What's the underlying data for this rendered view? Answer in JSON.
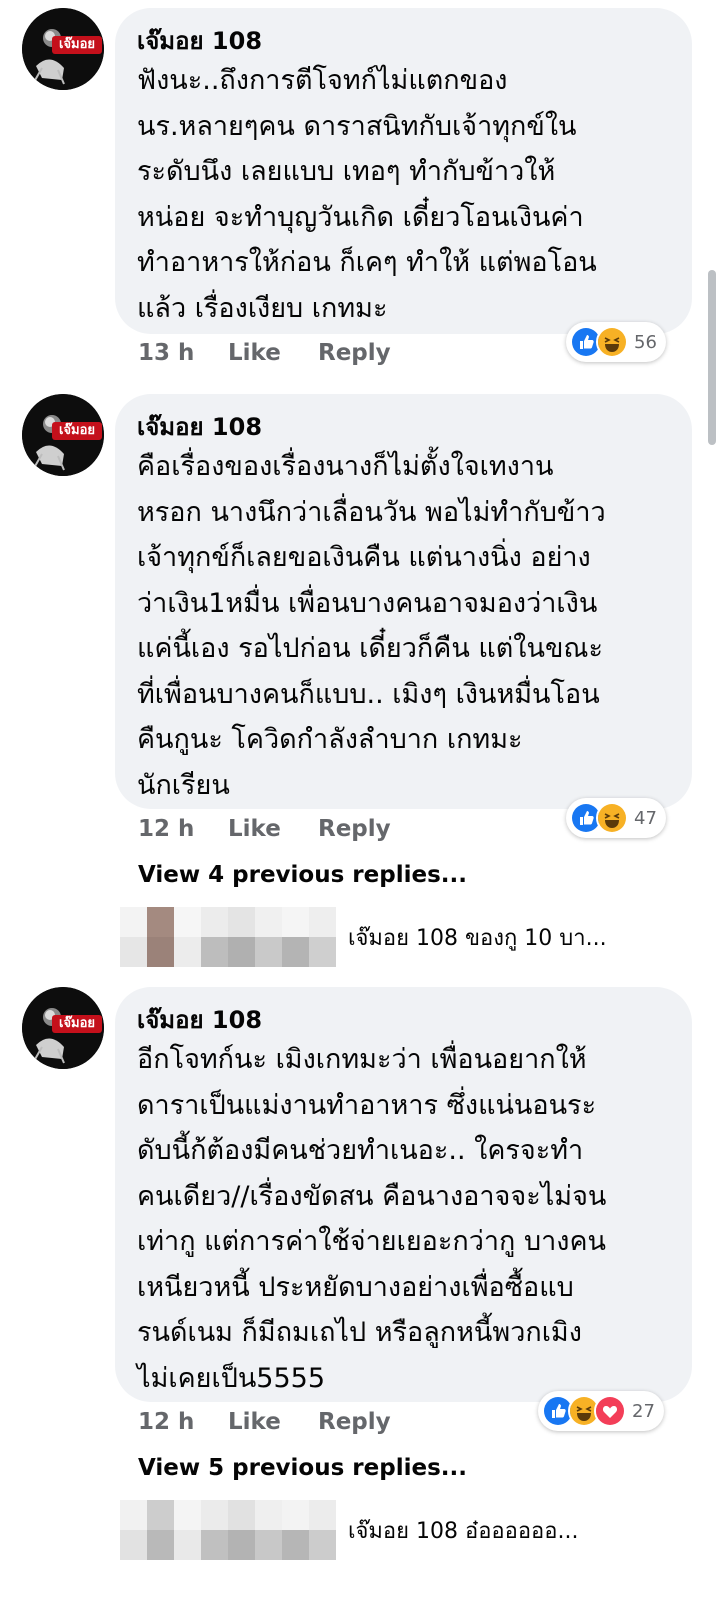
{
  "colors": {
    "like": "#1877f2",
    "haha": "#f7b125",
    "love": "#f33e58",
    "muted": "#65676b"
  },
  "avatar_label": "เจ๊มอย",
  "comments": [
    {
      "author": "เจ๊มอย 108",
      "text": "ฟังนะ..ถึงการตีโจทก์ไม่แตกของ\nนร.หลายๆคน ดาราสนิทกับเจ้าทุกข์ใน\nระดับนึง เลยแบบ เทอๆ ทำกับข้าวให้\nหน่อย จะทำบุญวันเกิด เดี๋ยวโอนเงินค่า\nทำอาหารให้ก่อน ก็เคๆ ทำให้ แต่พอโอน\nแล้ว เรื่องเงียบ เกทมะ",
      "time": "13 h",
      "like_label": "Like",
      "reply_label": "Reply",
      "reactions": [
        "like-icon",
        "haha-icon"
      ],
      "reaction_count": "56"
    },
    {
      "author": "เจ๊มอย 108",
      "text": "คือเรื่องของเรื่องนางก็ไม่ตั้งใจเทงาน\nหรอก นางนึกว่าเลื่อนวัน พอไม่ทำกับข้าว\nเจ้าทุกข์ก็เลยขอเงินคืน แต่นางนิ่ง อย่าง\nว่าเงิน1หมื่น เพื่อนบางคนอาจมองว่าเงิน\nแค่นี้เอง รอไปก่อน เดี๋ยวก็คืน แต่ในขณะ\nที่เพื่อนบางคนก็แบบ.. เมิงๆ เงินหมื่นโอน\nคืนกูนะ โควิดกำลังลำบาก เกทมะ\nนักเรียน",
      "time": "12 h",
      "like_label": "Like",
      "reply_label": "Reply",
      "reactions": [
        "like-icon",
        "haha-icon"
      ],
      "reaction_count": "47",
      "view_previous": "View 4 previous replies...",
      "reply_preview": "เจ๊มอย 108 ของกู 10 บา..."
    },
    {
      "author": "เจ๊มอย 108",
      "text": "อีกโจทก์นะ เมิงเกทมะว่า เพื่อนอยากให้\nดาราเป็นแม่งานทำอาหาร ซึ่งแน่นอนระ\nดับนี้ก้ต้องมีคนช่วยทำเนอะ.. ใครจะทำ\nคนเดียว//เรื่องขัดสน คือนางอาจจะไม่จน\nเท่ากู แต่การค่าใช้จ่ายเยอะกว่ากู บางคน\nเหนียวหนี้ ประหยัดบางอย่างเพื่อซื้อแบ\nรนด์เนม ก็มีถมเถไป หรือลูกหนี้พวกเมิง\nไม่เคยเป็น5555",
      "time": "12 h",
      "like_label": "Like",
      "reply_label": "Reply",
      "reactions": [
        "like-icon",
        "haha-icon",
        "love-icon"
      ],
      "reaction_count": "27",
      "view_previous": "View 5 previous replies...",
      "reply_preview": "เจ๊มอย 108 อ๋ออออออ..."
    }
  ]
}
